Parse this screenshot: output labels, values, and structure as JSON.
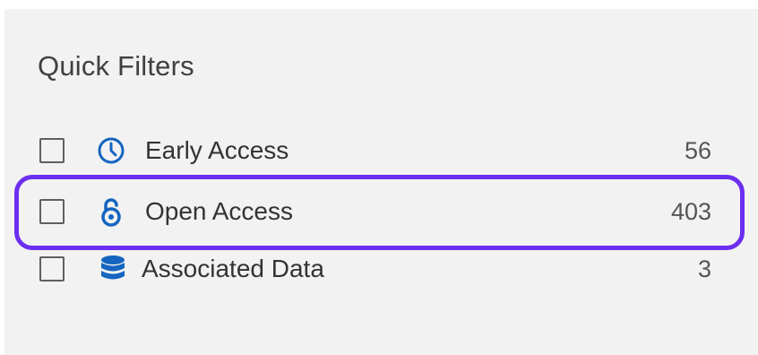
{
  "filters": {
    "title": "Quick Filters",
    "items": [
      {
        "label": "Early Access",
        "count": "56",
        "icon": "clock-icon",
        "checked": false
      },
      {
        "label": "Open Access",
        "count": "403",
        "icon": "open-access-lock-icon",
        "checked": false
      },
      {
        "label": "Associated Data",
        "count": "3",
        "icon": "database-icon",
        "checked": false
      }
    ]
  },
  "colors": {
    "panel_background": "#f2f2f2",
    "icon_blue": "#1565c0",
    "highlight_border": "#6b2ef0",
    "checkbox_border": "#5f5f5f"
  }
}
